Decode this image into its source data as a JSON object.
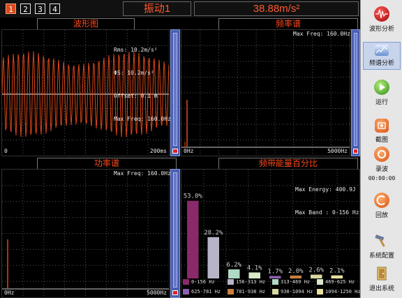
{
  "topbar": {
    "channels": [
      "1",
      "2",
      "3",
      "4"
    ],
    "active_channel": "1",
    "channel_name": "振动1",
    "reading": "38.88m/s²"
  },
  "waveform": {
    "title": "波形图",
    "info": [
      "Rms: 10.2m/s²",
      "ΦS: 10.2m/s²",
      "Offset: 0.1 m",
      "Max Freq: 160.0Hz"
    ],
    "x_start": "0",
    "x_end": "200ms"
  },
  "spectrum": {
    "title": "频率谱",
    "max_freq": "Max Freq: 160.0Hz",
    "x_start": "0Hz",
    "x_end": "5000Hz"
  },
  "power": {
    "title": "功率谱",
    "max_freq": "Max Freq: 160.0Hz",
    "x_start": "0Hz",
    "x_end": "5000Hz"
  },
  "band_energy": {
    "title": "频带能量百分比",
    "max_energy": "Max Energy: 400.9J",
    "max_band": "Max Band : 0-156 Hz"
  },
  "chart_data": {
    "type": "bar",
    "title": "频带能量百分比",
    "categories": [
      "0-156 Hz",
      "156-313 Hz",
      "313-469 Hz",
      "469-625 Hz",
      "625-781 Hz",
      "781-938 Hz",
      "938-1094 Hz",
      "1094-1250 Hz"
    ],
    "values": [
      53.0,
      28.2,
      6.2,
      4.1,
      1.7,
      2.0,
      2.6,
      2.1
    ],
    "value_labels": [
      "53.0%",
      "28.2%",
      "6.2%",
      "4.1%",
      "1.7%",
      "2.0%",
      "2.6%",
      "2.1%"
    ],
    "colors": [
      "#8a2a6a",
      "#b8b4c8",
      "#b0d8c4",
      "#d8e8c8",
      "#9060b0",
      "#c88040",
      "#d8d8a0",
      "#e8e0a0"
    ],
    "ylim": [
      0,
      60
    ]
  },
  "sidebar": {
    "items": [
      {
        "label": "波形分析",
        "icon": "waveform-analysis-icon"
      },
      {
        "label": "频谱分析",
        "icon": "spectrum-analysis-icon"
      },
      {
        "label": "运行",
        "icon": "run-icon"
      },
      {
        "label": "截图",
        "icon": "screenshot-icon"
      },
      {
        "label": "录波",
        "icon": "record-icon"
      },
      {
        "label": "回放",
        "icon": "playback-icon"
      },
      {
        "label": "系统配置",
        "icon": "system-config-icon"
      },
      {
        "label": "退出系统",
        "icon": "exit-icon"
      }
    ],
    "record_time": "00:00:00"
  }
}
